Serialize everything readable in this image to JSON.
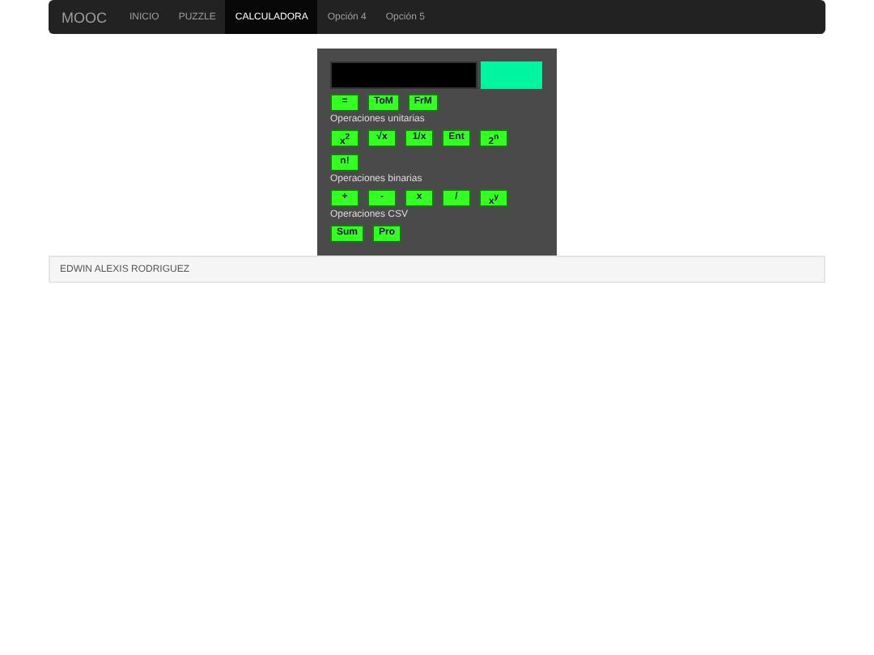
{
  "navbar": {
    "brand": "MOOC",
    "items": [
      {
        "label": "INICIO",
        "selected": false
      },
      {
        "label": "PUZZLE",
        "selected": false
      },
      {
        "label": "CALCULADORA",
        "selected": true
      },
      {
        "label": "Opción 4",
        "selected": false
      },
      {
        "label": "Opción 5",
        "selected": false
      }
    ]
  },
  "calculator": {
    "top_buttons": [
      "=",
      "ToM",
      "FrM"
    ],
    "sections": [
      {
        "title": "Operaciones unitarias",
        "buttons": [
          "x$^{2}$",
          "√x",
          "1/x",
          "Ent",
          "2$^{n}$",
          "n!"
        ]
      },
      {
        "title": "Operaciones binarias",
        "buttons": [
          "+",
          "-",
          "x",
          "/",
          "x$^{y}$"
        ]
      },
      {
        "title": "Operaciones CSV",
        "buttons": [
          "Sum",
          "Pro"
        ]
      }
    ]
  },
  "footer": {
    "text": "EDWIN ALEXIS RODRIGUEZ"
  }
}
